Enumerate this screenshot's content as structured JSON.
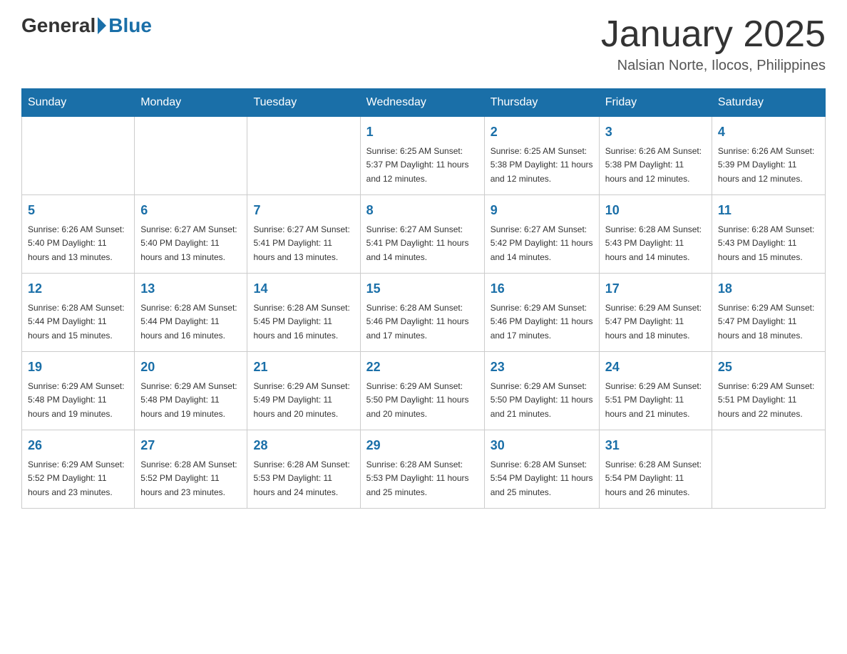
{
  "logo": {
    "general": "General",
    "blue": "Blue"
  },
  "title": {
    "month_year": "January 2025",
    "location": "Nalsian Norte, Ilocos, Philippines"
  },
  "headers": [
    "Sunday",
    "Monday",
    "Tuesday",
    "Wednesday",
    "Thursday",
    "Friday",
    "Saturday"
  ],
  "weeks": [
    [
      {
        "day": "",
        "info": ""
      },
      {
        "day": "",
        "info": ""
      },
      {
        "day": "",
        "info": ""
      },
      {
        "day": "1",
        "info": "Sunrise: 6:25 AM\nSunset: 5:37 PM\nDaylight: 11 hours\nand 12 minutes."
      },
      {
        "day": "2",
        "info": "Sunrise: 6:25 AM\nSunset: 5:38 PM\nDaylight: 11 hours\nand 12 minutes."
      },
      {
        "day": "3",
        "info": "Sunrise: 6:26 AM\nSunset: 5:38 PM\nDaylight: 11 hours\nand 12 minutes."
      },
      {
        "day": "4",
        "info": "Sunrise: 6:26 AM\nSunset: 5:39 PM\nDaylight: 11 hours\nand 12 minutes."
      }
    ],
    [
      {
        "day": "5",
        "info": "Sunrise: 6:26 AM\nSunset: 5:40 PM\nDaylight: 11 hours\nand 13 minutes."
      },
      {
        "day": "6",
        "info": "Sunrise: 6:27 AM\nSunset: 5:40 PM\nDaylight: 11 hours\nand 13 minutes."
      },
      {
        "day": "7",
        "info": "Sunrise: 6:27 AM\nSunset: 5:41 PM\nDaylight: 11 hours\nand 13 minutes."
      },
      {
        "day": "8",
        "info": "Sunrise: 6:27 AM\nSunset: 5:41 PM\nDaylight: 11 hours\nand 14 minutes."
      },
      {
        "day": "9",
        "info": "Sunrise: 6:27 AM\nSunset: 5:42 PM\nDaylight: 11 hours\nand 14 minutes."
      },
      {
        "day": "10",
        "info": "Sunrise: 6:28 AM\nSunset: 5:43 PM\nDaylight: 11 hours\nand 14 minutes."
      },
      {
        "day": "11",
        "info": "Sunrise: 6:28 AM\nSunset: 5:43 PM\nDaylight: 11 hours\nand 15 minutes."
      }
    ],
    [
      {
        "day": "12",
        "info": "Sunrise: 6:28 AM\nSunset: 5:44 PM\nDaylight: 11 hours\nand 15 minutes."
      },
      {
        "day": "13",
        "info": "Sunrise: 6:28 AM\nSunset: 5:44 PM\nDaylight: 11 hours\nand 16 minutes."
      },
      {
        "day": "14",
        "info": "Sunrise: 6:28 AM\nSunset: 5:45 PM\nDaylight: 11 hours\nand 16 minutes."
      },
      {
        "day": "15",
        "info": "Sunrise: 6:28 AM\nSunset: 5:46 PM\nDaylight: 11 hours\nand 17 minutes."
      },
      {
        "day": "16",
        "info": "Sunrise: 6:29 AM\nSunset: 5:46 PM\nDaylight: 11 hours\nand 17 minutes."
      },
      {
        "day": "17",
        "info": "Sunrise: 6:29 AM\nSunset: 5:47 PM\nDaylight: 11 hours\nand 18 minutes."
      },
      {
        "day": "18",
        "info": "Sunrise: 6:29 AM\nSunset: 5:47 PM\nDaylight: 11 hours\nand 18 minutes."
      }
    ],
    [
      {
        "day": "19",
        "info": "Sunrise: 6:29 AM\nSunset: 5:48 PM\nDaylight: 11 hours\nand 19 minutes."
      },
      {
        "day": "20",
        "info": "Sunrise: 6:29 AM\nSunset: 5:48 PM\nDaylight: 11 hours\nand 19 minutes."
      },
      {
        "day": "21",
        "info": "Sunrise: 6:29 AM\nSunset: 5:49 PM\nDaylight: 11 hours\nand 20 minutes."
      },
      {
        "day": "22",
        "info": "Sunrise: 6:29 AM\nSunset: 5:50 PM\nDaylight: 11 hours\nand 20 minutes."
      },
      {
        "day": "23",
        "info": "Sunrise: 6:29 AM\nSunset: 5:50 PM\nDaylight: 11 hours\nand 21 minutes."
      },
      {
        "day": "24",
        "info": "Sunrise: 6:29 AM\nSunset: 5:51 PM\nDaylight: 11 hours\nand 21 minutes."
      },
      {
        "day": "25",
        "info": "Sunrise: 6:29 AM\nSunset: 5:51 PM\nDaylight: 11 hours\nand 22 minutes."
      }
    ],
    [
      {
        "day": "26",
        "info": "Sunrise: 6:29 AM\nSunset: 5:52 PM\nDaylight: 11 hours\nand 23 minutes."
      },
      {
        "day": "27",
        "info": "Sunrise: 6:28 AM\nSunset: 5:52 PM\nDaylight: 11 hours\nand 23 minutes."
      },
      {
        "day": "28",
        "info": "Sunrise: 6:28 AM\nSunset: 5:53 PM\nDaylight: 11 hours\nand 24 minutes."
      },
      {
        "day": "29",
        "info": "Sunrise: 6:28 AM\nSunset: 5:53 PM\nDaylight: 11 hours\nand 25 minutes."
      },
      {
        "day": "30",
        "info": "Sunrise: 6:28 AM\nSunset: 5:54 PM\nDaylight: 11 hours\nand 25 minutes."
      },
      {
        "day": "31",
        "info": "Sunrise: 6:28 AM\nSunset: 5:54 PM\nDaylight: 11 hours\nand 26 minutes."
      },
      {
        "day": "",
        "info": ""
      }
    ]
  ]
}
